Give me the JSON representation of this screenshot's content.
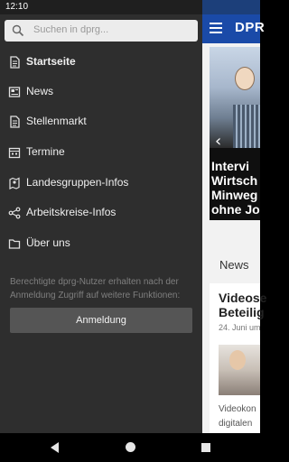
{
  "status_bar": {
    "time": "12:10"
  },
  "background_app": {
    "logo": "DPR",
    "hero_headline_lines": [
      "Intervi",
      "Wirtsch",
      "Minweg",
      "ohne Jo"
    ],
    "news_section_title": "News",
    "card": {
      "title_lines": [
        "Videose",
        "Beteilig"
      ],
      "date": "24. Juni um",
      "snippet_lines": [
        "Videokon",
        "digitalen"
      ]
    }
  },
  "drawer": {
    "search": {
      "placeholder": "Suchen in dprg..."
    },
    "items": [
      {
        "label": "Startseite",
        "icon": "document-icon",
        "active": true
      },
      {
        "label": "News",
        "icon": "newspaper-icon",
        "active": false
      },
      {
        "label": "Stellenmarkt",
        "icon": "document-icon",
        "active": false
      },
      {
        "label": "Termine",
        "icon": "calendar-icon",
        "active": false
      },
      {
        "label": "Landesgruppen-Infos",
        "icon": "map-icon",
        "active": false
      },
      {
        "label": "Arbeitskreise-Infos",
        "icon": "share-icon",
        "active": false
      },
      {
        "label": "Über uns",
        "icon": "folder-icon",
        "active": false
      }
    ],
    "info_text": "Berechtigte dprg-Nutzer erhalten nach der Anmeldung Zugriff auf weitere Funktionen:",
    "login_button": "Anmeldung"
  }
}
